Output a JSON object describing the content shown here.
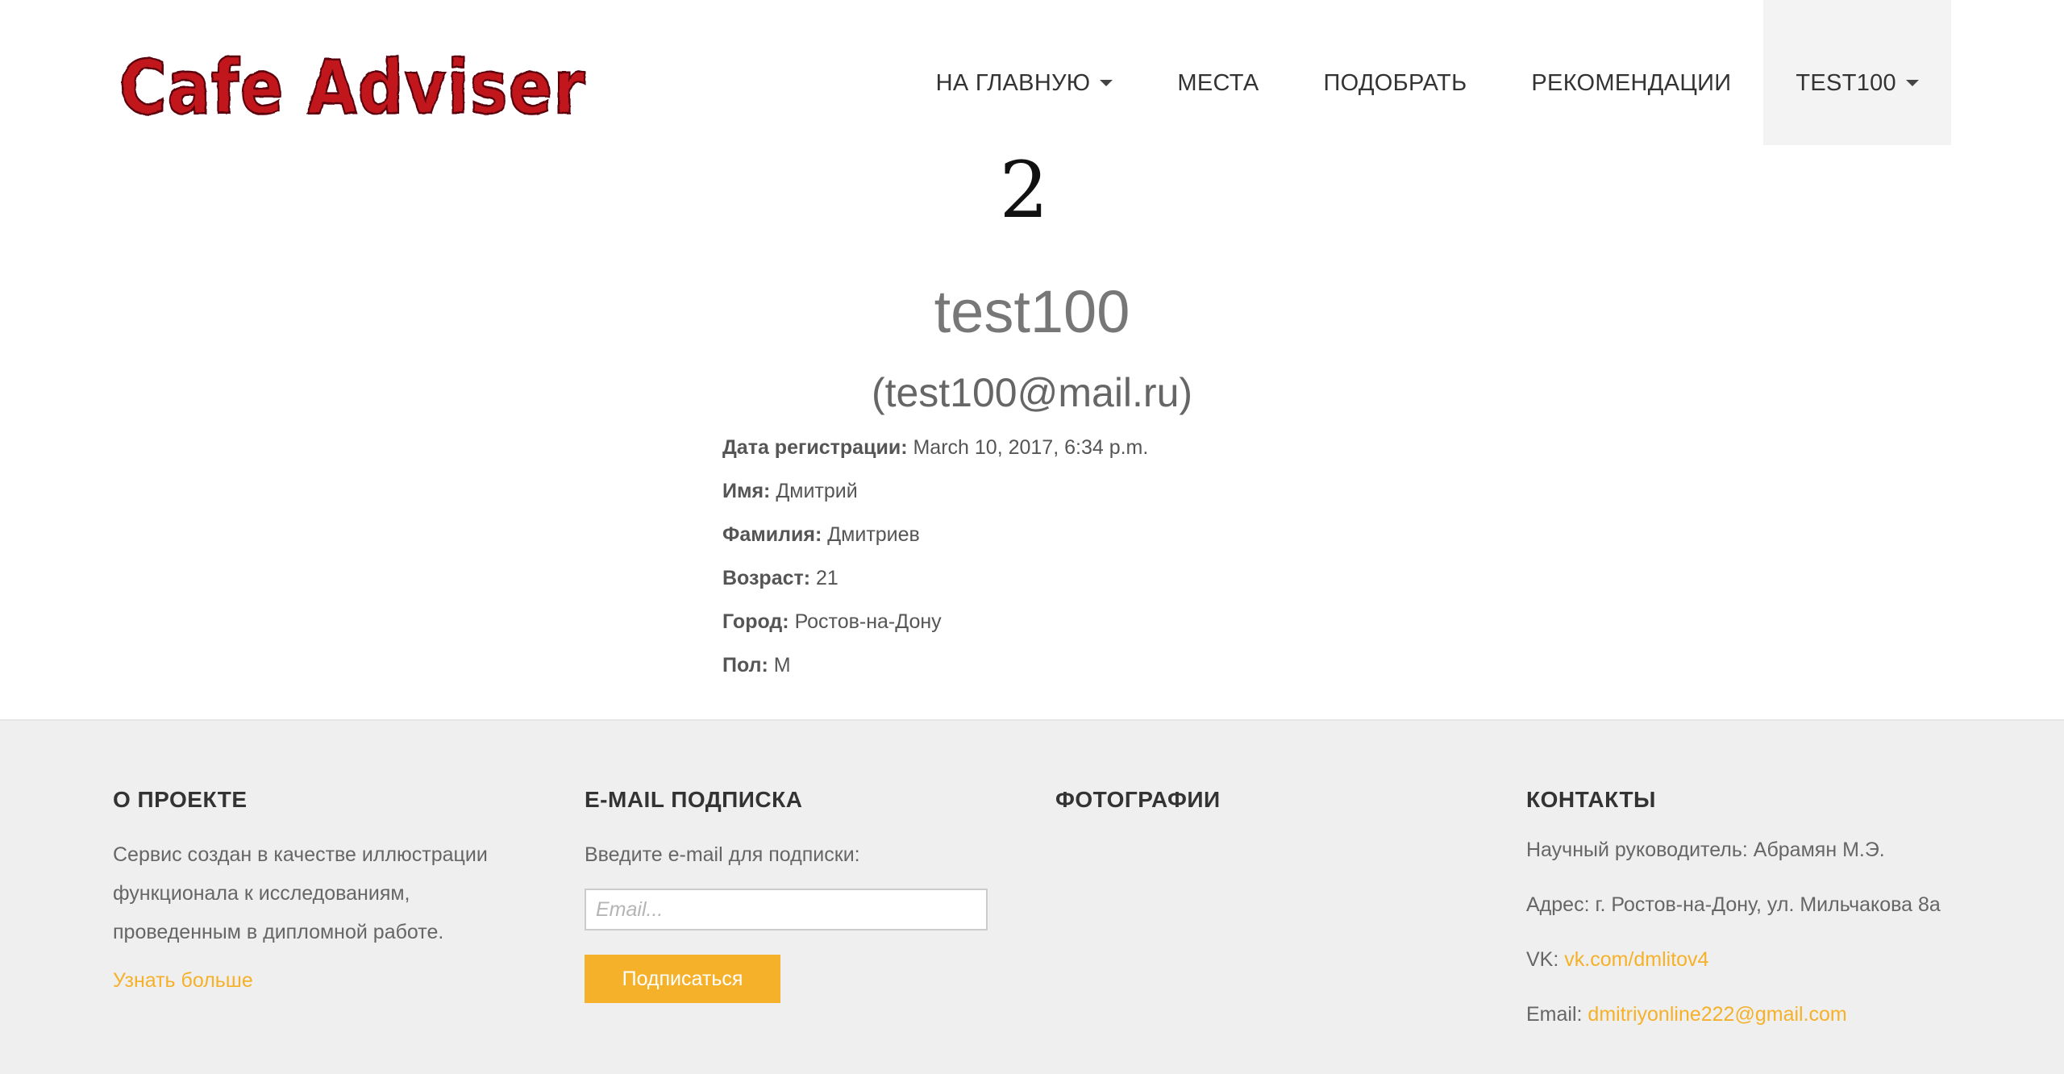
{
  "brand": {
    "logo_text": "Cafe Adviser",
    "logo_color": "#c0161e"
  },
  "nav": {
    "items": [
      {
        "label": "НА ГЛАВНУЮ",
        "dropdown": true
      },
      {
        "label": "МЕСТА",
        "dropdown": false
      },
      {
        "label": "ПОДОБРАТЬ",
        "dropdown": false
      },
      {
        "label": "РЕКОМЕНДАЦИИ",
        "dropdown": false
      },
      {
        "label": "TEST100",
        "dropdown": true,
        "active": true
      }
    ]
  },
  "profile": {
    "avatar_text": "2",
    "username": "test100",
    "email_display": "(test100@mail.ru)",
    "details": [
      {
        "label": "Дата регистрации:",
        "value": "March 10, 2017, 6:34 p.m."
      },
      {
        "label": "Имя:",
        "value": "Дмитрий"
      },
      {
        "label": "Фамилия:",
        "value": "Дмитриев"
      },
      {
        "label": "Возраст:",
        "value": "21"
      },
      {
        "label": "Город:",
        "value": "Ростов-на-Дону"
      },
      {
        "label": "Пол:",
        "value": "М"
      }
    ]
  },
  "footer": {
    "about": {
      "title": "О ПРОЕКТЕ",
      "text": "Сервис создан в качестве иллюстрации функционала к исследованиям, проведенным в дипломной работе.",
      "more_link": "Узнать больше"
    },
    "subscribe": {
      "title": "E-MAIL ПОДПИСКА",
      "prompt": "Введите e-mail для подписки:",
      "placeholder": "Email...",
      "button_label": "Подписаться"
    },
    "photos": {
      "title": "ФОТОГРАФИИ"
    },
    "contacts": {
      "title": "КОНТАКТЫ",
      "supervisor": "Научный руководитель: Абрамян М.Э.",
      "address": "Адрес: г. Ростов-на-Дону, ул. Мильчакова 8а",
      "vk_label": "VK:",
      "vk_link": "vk.com/dmlitov4",
      "email_label": "Email:",
      "email_link": "dmitriyonline222@gmail.com"
    },
    "accent_color": "#f5b12a"
  }
}
